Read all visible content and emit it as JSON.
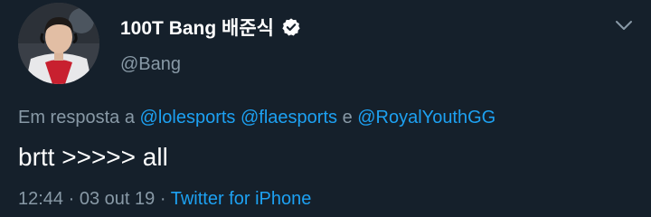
{
  "tweet": {
    "author": {
      "display_name": "100T Bang 배준식",
      "handle": "@Bang"
    },
    "reply": {
      "prefix": "Em resposta a",
      "mentions": [
        "@lolesports",
        "@flaesports",
        "@RoyalYouthGG"
      ],
      "conjunction": "e"
    },
    "text": "brtt >>>>> all",
    "time": "12:44",
    "separator": "·",
    "date": "03 out 19",
    "source": "Twitter for iPhone"
  },
  "icons": {
    "verified": "verified-badge-icon",
    "menu": "chevron-down-icon"
  },
  "colors": {
    "background": "#15202b",
    "primary_text": "#ffffff",
    "secondary_text": "#8899a6",
    "link": "#1da1f2"
  }
}
